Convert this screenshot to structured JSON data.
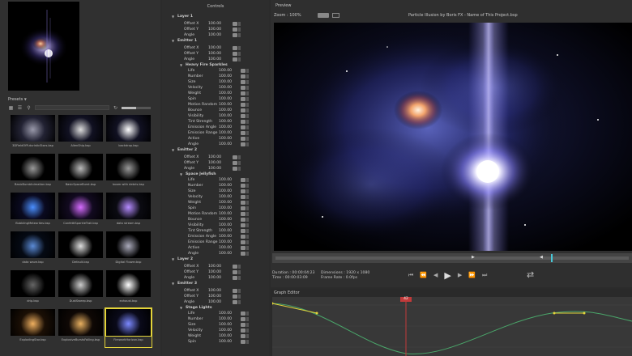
{
  "presets": {
    "title": "Presets",
    "items": [
      {
        "name": "3DFieldOfFuturisticStars.bsp",
        "selected": false
      },
      {
        "name": "AlienShip.bsp",
        "selected": false
      },
      {
        "name": "backdrop.bsp",
        "selected": false
      },
      {
        "name": "BasicBurstAnimation.bsp",
        "selected": false
      },
      {
        "name": "BasicSpaceBurst.bsp",
        "selected": false
      },
      {
        "name": "boom with debris.bsp",
        "selected": false
      },
      {
        "name": "BubblingMeteorites.bsp",
        "selected": false
      },
      {
        "name": "ConfettiSparkleTrail.bsp",
        "selected": false
      },
      {
        "name": "data stream.bsp",
        "selected": false
      },
      {
        "name": "data wave.bsp",
        "selected": false
      },
      {
        "name": "Default.bsp",
        "selected": false
      },
      {
        "name": "Digital Flower.bsp",
        "selected": false
      },
      {
        "name": "drip.bsp",
        "selected": false
      },
      {
        "name": "DustSweep.bsp",
        "selected": false
      },
      {
        "name": "exhaust.bsp",
        "selected": false
      },
      {
        "name": "ExplodingStar.bsp",
        "selected": false
      },
      {
        "name": "ExplosiveBurstsFalling.bsp",
        "selected": false
      },
      {
        "name": "FireworkHorizon.bsp",
        "selected": true
      }
    ]
  },
  "controls": {
    "title": "Controls",
    "rows": [
      {
        "type": "section",
        "label": "Layer 1"
      },
      {
        "type": "param",
        "label": "Offset X",
        "value": "100.00"
      },
      {
        "type": "param",
        "label": "Offset Y",
        "value": "100.00"
      },
      {
        "type": "param",
        "label": "Angle",
        "value": "100.00"
      },
      {
        "type": "section",
        "label": "Emitter 1"
      },
      {
        "type": "param",
        "label": "Offset X",
        "value": "100.00"
      },
      {
        "type": "param",
        "label": "Offset Y",
        "value": "100.00"
      },
      {
        "type": "param",
        "label": "Angle",
        "value": "100.00"
      },
      {
        "type": "subsection",
        "label": "Heavy Fire Sparkles"
      },
      {
        "type": "param2",
        "label": "Life",
        "value": "100.00"
      },
      {
        "type": "param2",
        "label": "Number",
        "value": "100.00"
      },
      {
        "type": "param2",
        "label": "Size",
        "value": "100.00"
      },
      {
        "type": "param2",
        "label": "Velocity",
        "value": "100.00"
      },
      {
        "type": "param2",
        "label": "Weight",
        "value": "100.00"
      },
      {
        "type": "param2",
        "label": "Spin",
        "value": "100.00"
      },
      {
        "type": "param2",
        "label": "Motion Random",
        "value": "100.00"
      },
      {
        "type": "param2",
        "label": "Bounce",
        "value": "100.00"
      },
      {
        "type": "param2",
        "label": "Visibility",
        "value": "100.00"
      },
      {
        "type": "param2",
        "label": "Tint Strength",
        "value": "100.00"
      },
      {
        "type": "param2",
        "label": "Emission Angle",
        "value": "100.00"
      },
      {
        "type": "param2",
        "label": "Emission Range",
        "value": "100.00"
      },
      {
        "type": "param2",
        "label": "Active",
        "value": "100.00"
      },
      {
        "type": "param2",
        "label": "Angle",
        "value": "100.00"
      },
      {
        "type": "section",
        "label": "Emitter 2"
      },
      {
        "type": "param",
        "label": "Offset X",
        "value": "100.00"
      },
      {
        "type": "param",
        "label": "Offset Y",
        "value": "100.00"
      },
      {
        "type": "param",
        "label": "Angle",
        "value": "100.00"
      },
      {
        "type": "subsection",
        "label": "Space Jellyfish"
      },
      {
        "type": "param2",
        "label": "Life",
        "value": "100.00"
      },
      {
        "type": "param2",
        "label": "Number",
        "value": "100.00"
      },
      {
        "type": "param2",
        "label": "Size",
        "value": "100.00"
      },
      {
        "type": "param2",
        "label": "Velocity",
        "value": "100.00"
      },
      {
        "type": "param2",
        "label": "Weight",
        "value": "100.00"
      },
      {
        "type": "param2",
        "label": "Spin",
        "value": "100.00"
      },
      {
        "type": "param2",
        "label": "Motion Random",
        "value": "100.00"
      },
      {
        "type": "param2",
        "label": "Bounce",
        "value": "100.00"
      },
      {
        "type": "param2",
        "label": "Visibility",
        "value": "100.00"
      },
      {
        "type": "param2",
        "label": "Tint Strength",
        "value": "100.00"
      },
      {
        "type": "param2",
        "label": "Emission Angle",
        "value": "100.00"
      },
      {
        "type": "param2",
        "label": "Emission Range",
        "value": "100.00"
      },
      {
        "type": "param2",
        "label": "Active",
        "value": "100.00"
      },
      {
        "type": "param2",
        "label": "Angle",
        "value": "100.00"
      },
      {
        "type": "section",
        "label": "Layer 2"
      },
      {
        "type": "param",
        "label": "Offset X",
        "value": "100.00"
      },
      {
        "type": "param",
        "label": "Offset Y",
        "value": "100.00"
      },
      {
        "type": "param",
        "label": "Angle",
        "value": "100.00"
      },
      {
        "type": "section",
        "label": "Emitter 3"
      },
      {
        "type": "param",
        "label": "Offset X",
        "value": "100.00"
      },
      {
        "type": "param",
        "label": "Offset Y",
        "value": "100.00"
      },
      {
        "type": "param",
        "label": "Angle",
        "value": "100.00"
      },
      {
        "type": "subsection",
        "label": "Stage Lights"
      },
      {
        "type": "param2",
        "label": "Life",
        "value": "100.00"
      },
      {
        "type": "param2",
        "label": "Number",
        "value": "100.00"
      },
      {
        "type": "param2",
        "label": "Size",
        "value": "100.00"
      },
      {
        "type": "param2",
        "label": "Velocity",
        "value": "100.00"
      },
      {
        "type": "param2",
        "label": "Weight",
        "value": "100.00"
      },
      {
        "type": "param2",
        "label": "Spin",
        "value": "100.00"
      }
    ]
  },
  "preview": {
    "title": "Preview",
    "zoom": "Zoom : 100%",
    "project": "Particle Illusion by Boris FX - Name of This Project.bsp",
    "duration": "Duration : 00:00:04:23",
    "time": "Time : 00:00:03:09",
    "dimensions": "Dimensions : 1920 x 1080",
    "frame_rate": "Frame Rate : 0.0fps",
    "playhead_fraction": 0.78
  },
  "graph": {
    "title": "Graph Editor",
    "marker": "42"
  },
  "colors": {
    "accent_yellow": "#e4d43a",
    "curve_green": "#4aa66a",
    "marker_red": "#c23a3a"
  }
}
